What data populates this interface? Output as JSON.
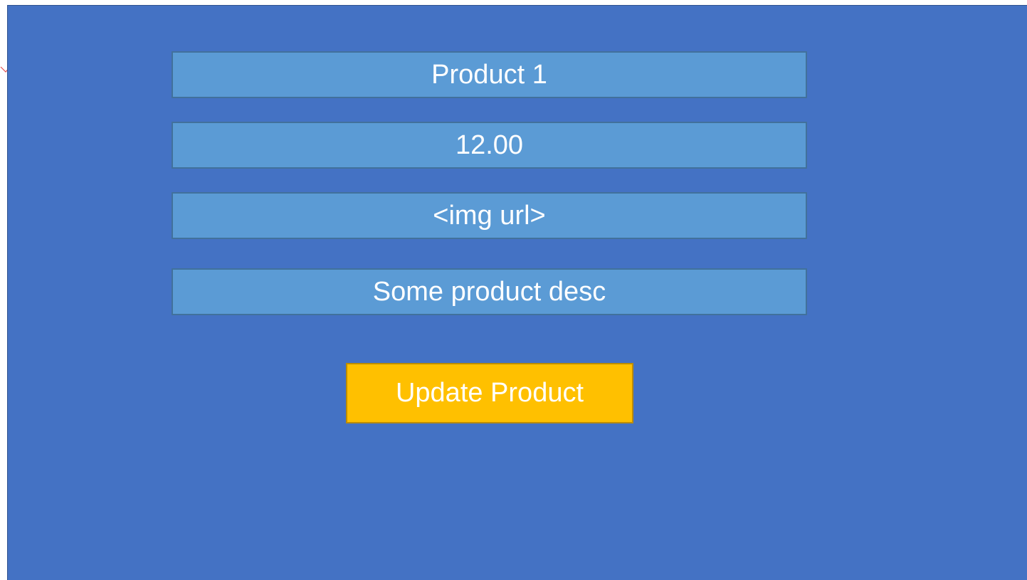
{
  "form": {
    "name_value": "Product 1",
    "price_value": "12.00",
    "image_url_value": "<img url>",
    "description_value": "Some product desc"
  },
  "actions": {
    "update_label": "Update Product"
  },
  "colors": {
    "panel_background": "#4472c4",
    "field_background": "#5b9bd5",
    "button_background": "#ffc000",
    "text": "#ffffff",
    "edge_mark": "#e05050"
  },
  "icons": {
    "edge_mark": "chevron-down-icon"
  }
}
